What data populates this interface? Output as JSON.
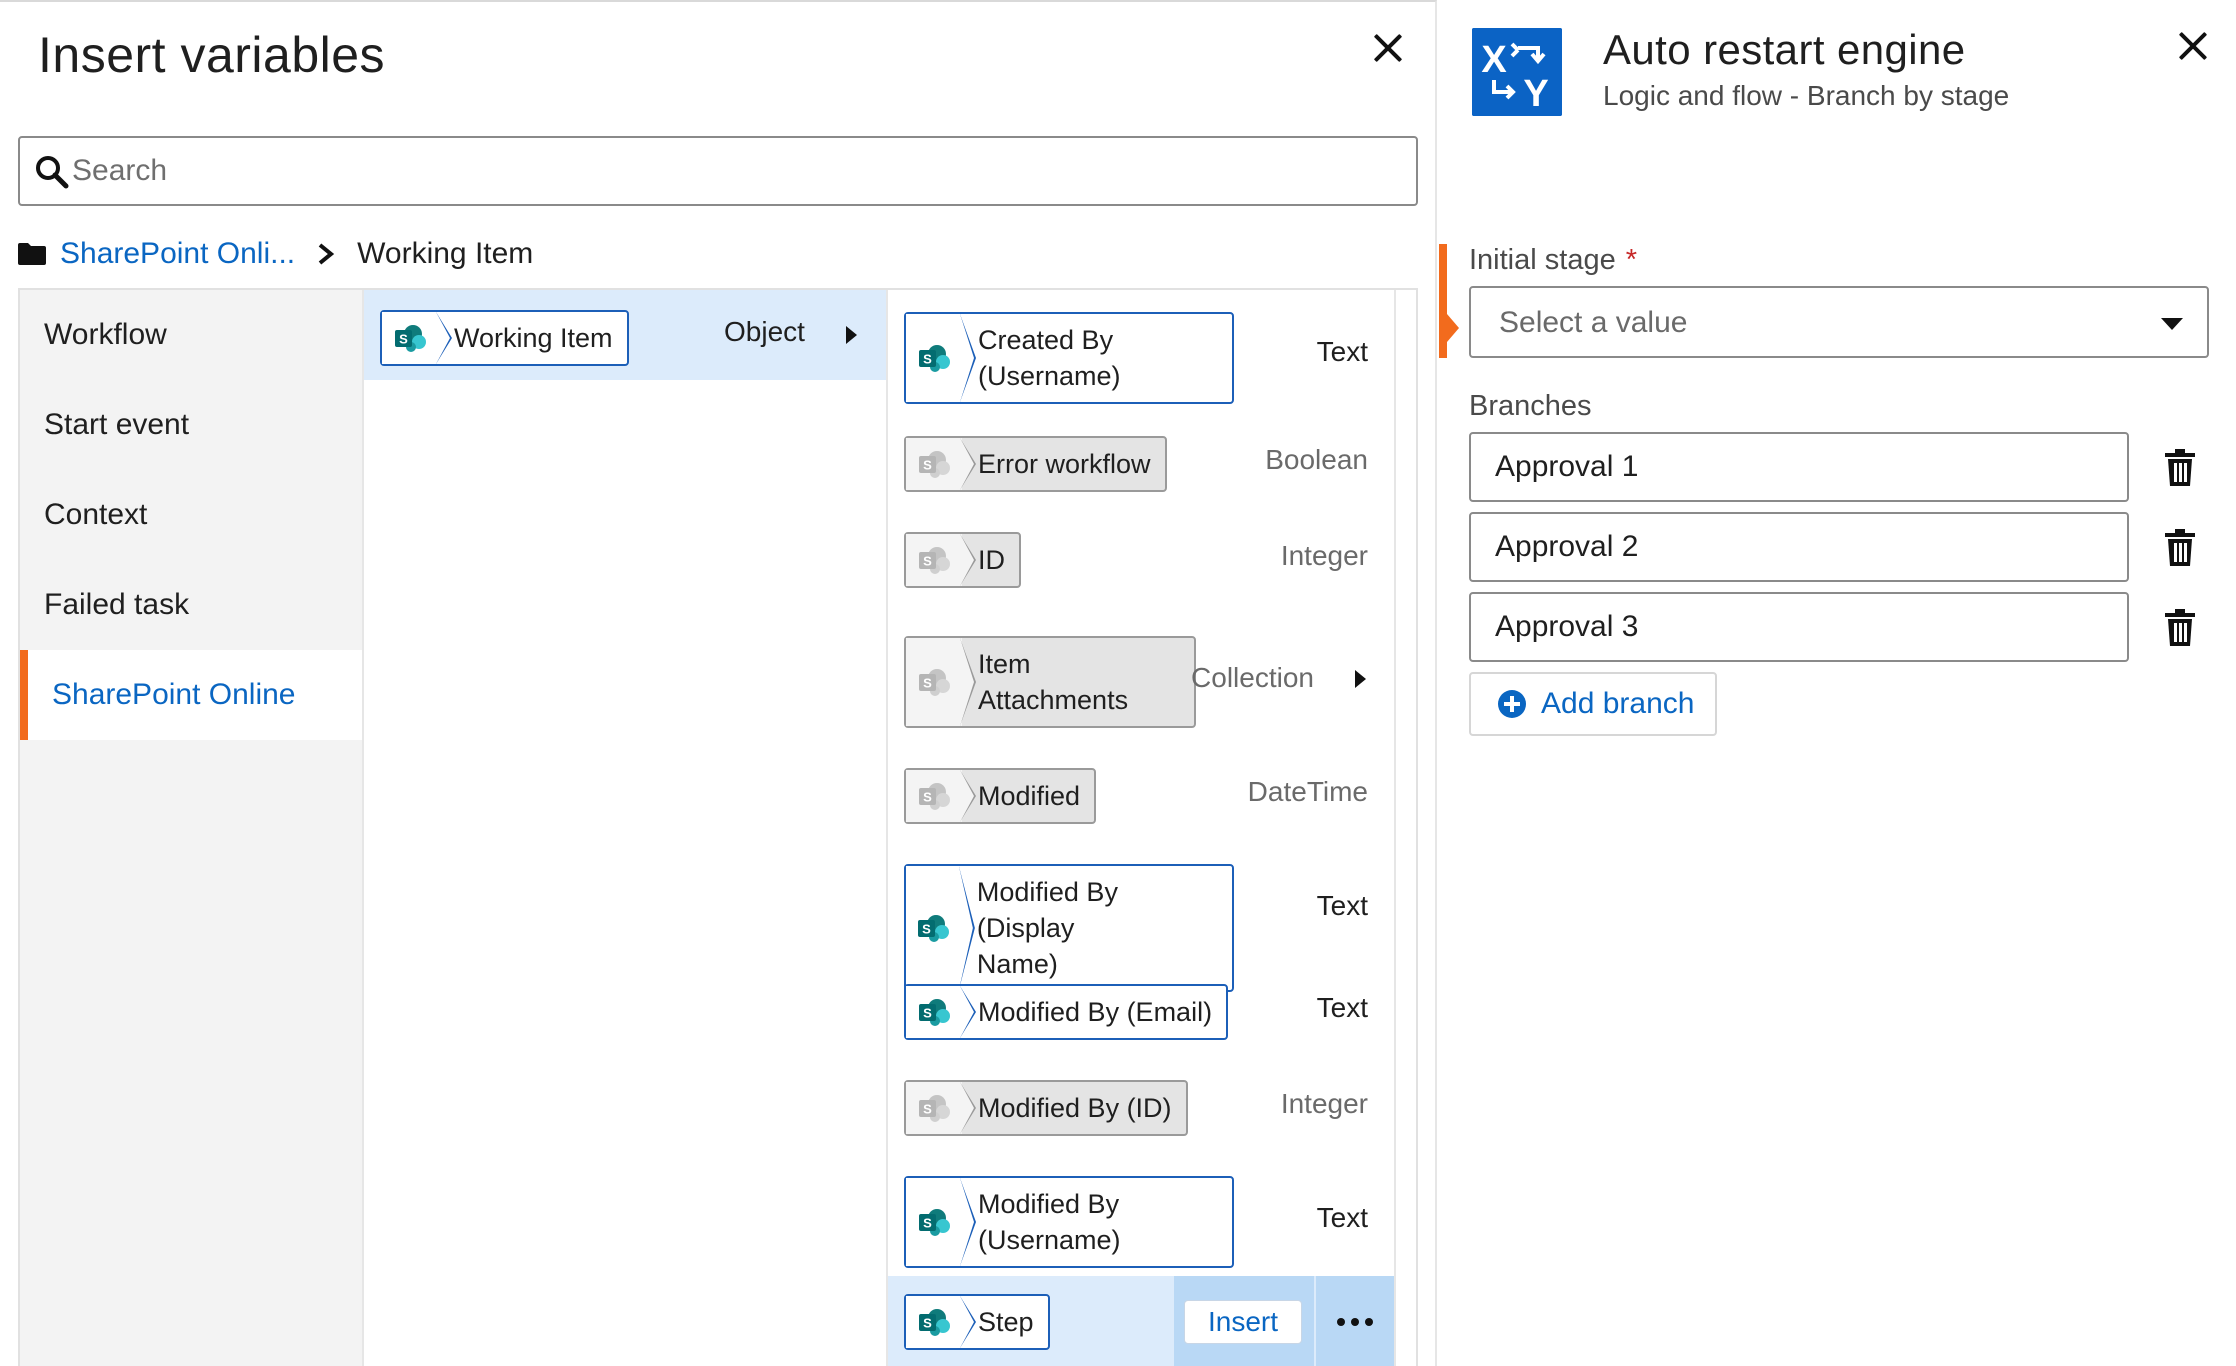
{
  "insert_modal": {
    "title": "Insert variables",
    "search": {
      "placeholder": "Search",
      "value": ""
    },
    "breadcrumb": {
      "root": "SharePoint Onli...",
      "current": "Working Item"
    },
    "categories": [
      {
        "label": "Workflow",
        "active": false
      },
      {
        "label": "Start event",
        "active": false
      },
      {
        "label": "Context",
        "active": false
      },
      {
        "label": "Failed task",
        "active": false
      },
      {
        "label": "SharePoint Online",
        "active": true
      }
    ],
    "object_column": {
      "label": "Working Item",
      "type": "Object"
    },
    "variables": [
      {
        "line1": "Created By",
        "line2": "(Username)",
        "type": "Text",
        "style": "blue"
      },
      {
        "line1": "Error workflow",
        "type": "Boolean",
        "style": "grey"
      },
      {
        "line1": "ID",
        "type": "Integer",
        "style": "grey"
      },
      {
        "line1": "Item",
        "line2": "Attachments",
        "type": "Collection",
        "style": "grey"
      },
      {
        "line1": "Modified",
        "type": "DateTime",
        "style": "grey"
      },
      {
        "line1": "Modified By (Display",
        "line2": "Name)",
        "type": "Text",
        "style": "blue"
      },
      {
        "line1": "Modified By (Email)",
        "type": "Text",
        "style": "blue"
      },
      {
        "line1": "Modified By (ID)",
        "type": "Integer",
        "style": "grey"
      },
      {
        "line1": "Modified By",
        "line2": "(Username)",
        "type": "Text",
        "style": "blue"
      },
      {
        "line1": "Step",
        "style": "blue",
        "selected": true
      }
    ],
    "insert_label": "Insert"
  },
  "config_panel": {
    "icon_text_top": "X",
    "icon_text_bottom": "Y",
    "title": "Auto restart engine",
    "subtitle": "Logic and flow - Branch by stage",
    "initial_stage": {
      "label": "Initial stage",
      "required": "*",
      "placeholder": "Select a value"
    },
    "branches_label": "Branches",
    "branches": [
      "Approval 1",
      "Approval 2",
      "Approval 3"
    ],
    "add_branch_label": "Add branch"
  },
  "colors": {
    "accent_blue": "#0a66c2",
    "chip_border_blue": "#1c5fb8",
    "selection_blue": "#dcebfb",
    "accent_orange": "#f26b1d",
    "app_icon_blue": "#0b63c5",
    "sharepoint_teal": "#0f7b7b"
  }
}
